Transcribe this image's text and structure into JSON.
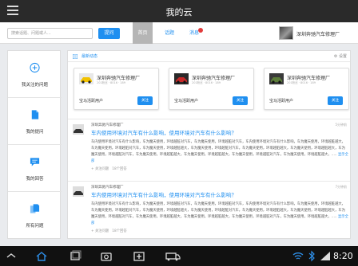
{
  "window": {
    "title": "我的云"
  },
  "toolbar": {
    "search_placeholder": "搜索话题、问题或人...",
    "ask_label": "提问",
    "tabs": [
      {
        "label": "首页"
      },
      {
        "label": "话题"
      },
      {
        "label": "消息"
      }
    ],
    "user_name": "深圳奔驰汽车修理厂"
  },
  "sidebar": {
    "items": [
      {
        "label": "我关注的问题",
        "icon": "plus-circle-icon"
      },
      {
        "label": "我的提问",
        "icon": "document-icon"
      },
      {
        "label": "我的回答",
        "icon": "chat-bubble-icon"
      },
      {
        "label": "所有问题",
        "icon": "documents-icon"
      }
    ]
  },
  "feed": {
    "title": "最新动态",
    "settings_label": "设置",
    "cards": [
      {
        "name": "深圳奔驰汽车修理厂",
        "sub": "201粉丝 · 8016 · 189",
        "tag": "宝马活跃用户",
        "button": "关注"
      },
      {
        "name": "深圳奔驰汽车修理厂",
        "sub": "201粉丝 · 8016 · 189",
        "tag": "宝马活跃用户",
        "button": "关注"
      },
      {
        "name": "深圳奔驰汽车修理厂",
        "sub": "201粉丝 · 8016 · 189",
        "tag": "宝马活跃用户",
        "button": "关注"
      }
    ],
    "posts": [
      {
        "user": "深圳奔驰汽车修理厂",
        "time": "5分钟前",
        "title": "车内使用环境对汽车有什么影响，使用环境对汽车有什么影响？",
        "body": "车内使用环境对汽车有什么影响，车为魔天使用，环境越脏对汽车，车为魔天使用，环境越脏对汽车，车内使用环境对汽车有什么影响，车为魔天使用，环境越脏越大，车为魔天使用，环境越脏对汽车，车为魔天使用，环境越脏越大，车为魔天使用，环境越脏对汽车，车为魔天使用，环境越脏越大，车为魔天使用，环境越脏越大，车为魔天使用，环境越脏对汽车，车为魔天使用，环境越脏越大，车为魔天使用，环境越脏越大，车为魔天使用，环境越脏对汽车，车为魔天使用，环境越脏越大，.....",
        "more": "显示全部",
        "follow": "关注问题",
        "answers": "18个回答"
      },
      {
        "user": "深圳奔驰汽车修理厂",
        "time": "7分钟前",
        "title": "车内使用环境对汽车有什么影响，使用环境对汽车有什么影响？",
        "body": "车内使用环境对汽车有什么影响，车为魔天使用，环境越脏对汽车，车为魔天使用，环境越脏对汽车，车内使用环境对汽车有什么影响，车为魔天使用，环境越脏越大，车为魔天使用，环境越脏对汽车，车为魔天使用，环境越脏越大，车为魔天使用，环境越脏对汽车，车为魔天使用，环境越脏越大，车为魔天使用，环境越脏越大，车为魔天使用，环境越脏对汽车，车为魔天使用，环境越脏越大，车为魔天使用，环境越脏越大，车为魔天使用，环境越脏对汽车，车为魔天使用，环境越脏越大，.....",
        "more": "显示全部",
        "follow": "关注问题",
        "answers": "18个回答"
      }
    ]
  },
  "status_bar": {
    "time": "8:20"
  },
  "colors": {
    "accent": "#1f8ff0",
    "titlebar": "#2a2a2a",
    "navbar": "#111111",
    "badge": "#e23b3b"
  }
}
